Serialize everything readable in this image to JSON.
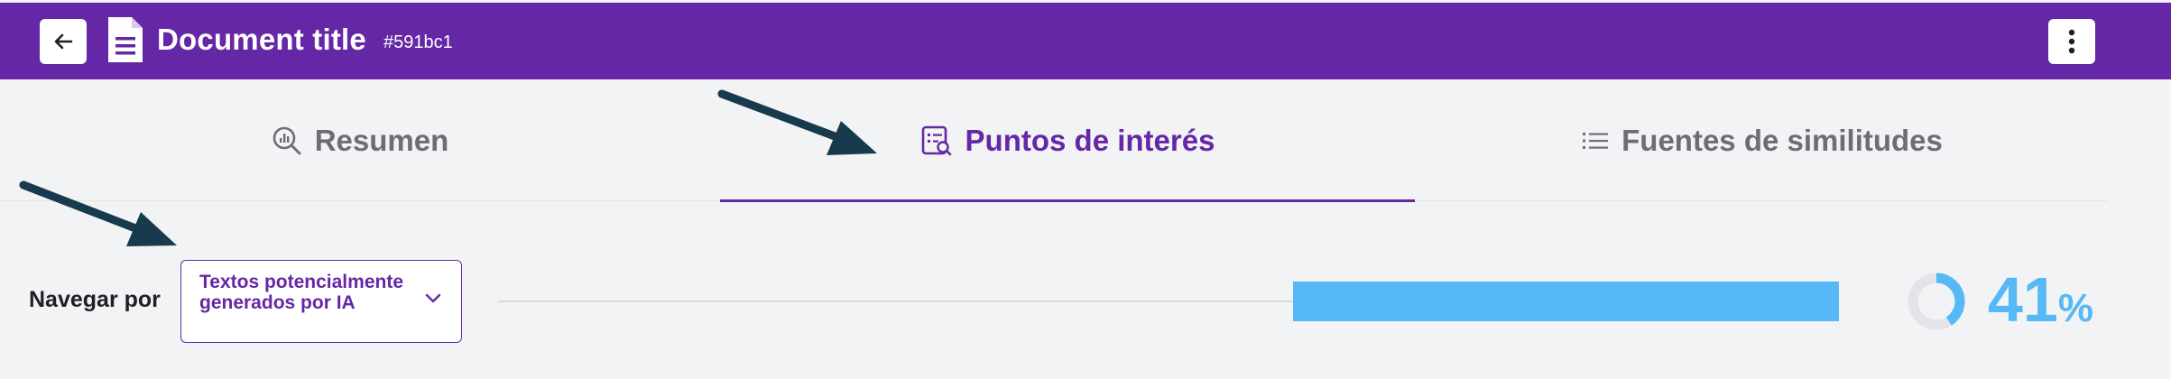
{
  "header": {
    "title": "Document title",
    "doc_id": "#591bc1",
    "colors": {
      "brand": "#6527a5",
      "accent": "#56b8f5"
    }
  },
  "tabs": [
    {
      "label": "Resumen",
      "icon": "analytics-search-icon",
      "active": false
    },
    {
      "label": "Puntos de interés",
      "icon": "report-search-icon",
      "active": true
    },
    {
      "label": "Fuentes de similitudes",
      "icon": "list-icon",
      "active": false
    }
  ],
  "navigation": {
    "label": "Navegar por",
    "selected": "Textos potencialmente generados por IA"
  },
  "score": {
    "value": 41,
    "number": "41",
    "unit": "%"
  }
}
